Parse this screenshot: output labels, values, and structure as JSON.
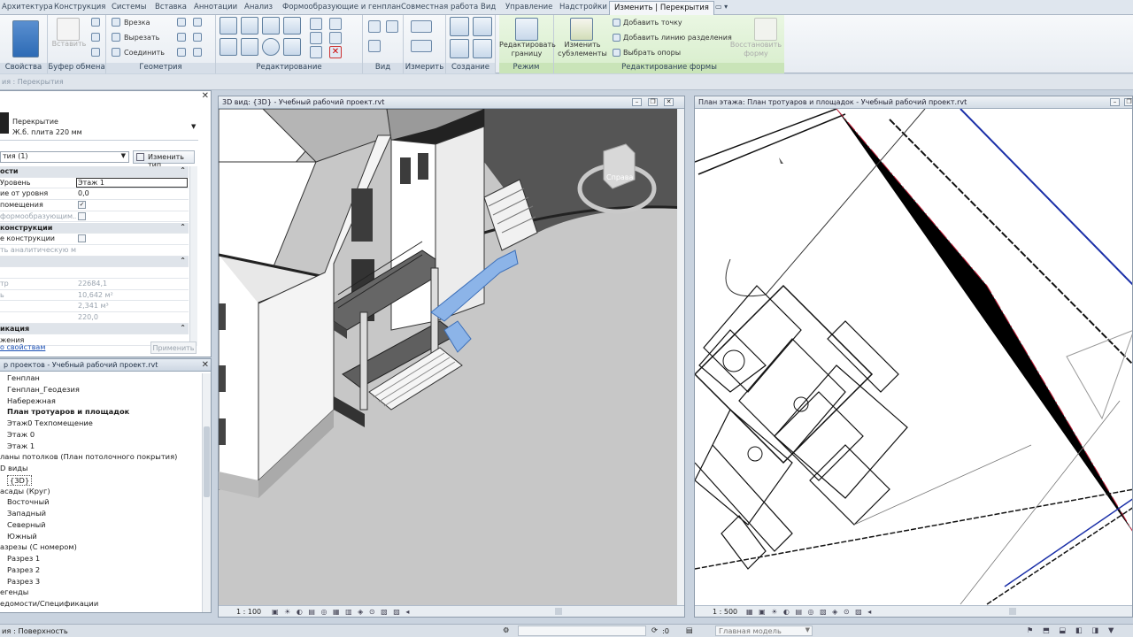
{
  "ribbon_tabs": [
    "Архитектура",
    "Конструкция",
    "Системы",
    "Вставка",
    "Аннотации",
    "Анализ",
    "Формообразующие и генплан",
    "Совместная работа",
    "Вид",
    "Управление",
    "Надстройки",
    "Изменить | Перекрытия"
  ],
  "ribbon": {
    "groups": {
      "properties": "Свойства",
      "clipboard": "Буфер обмена",
      "geometry": "Геометрия",
      "modify": "Редактирование",
      "view": "Вид",
      "measure": "Измерить",
      "create": "Создание",
      "mode": "Режим",
      "shape_editing": "Редактирование формы"
    },
    "paste": "Вставить",
    "notch": "Врезка",
    "cut": "Вырезать",
    "join": "Соединить",
    "edit_boundary": "Редактировать границу",
    "modify_subelements": "Изменить субэлементы",
    "add_point": "Добавить точку",
    "add_split_line": "Добавить линию разделения",
    "pick_supports": "Выбрать опоры",
    "reset_shape": "Восстановить форму"
  },
  "options_bar": "ия : Перекрытия",
  "properties": {
    "family": "Перекрытие",
    "type": "Ж.б. плита 220 мм",
    "filter": "тия (1)",
    "edit_type": "Изменить тип",
    "rows": [
      {
        "k": "ости",
        "v": "",
        "sec": true
      },
      {
        "k": "Уровень",
        "v": "Этаж 1",
        "edit": true
      },
      {
        "k": "ие от уровня",
        "v": "0,0"
      },
      {
        "k": "помещения",
        "v": "",
        "check": "✓"
      },
      {
        "k": "формообразующим...",
        "v": "",
        "check": "",
        "dim": true
      },
      {
        "k": "конструкции",
        "v": "",
        "sec": true
      },
      {
        "k": "е конструкции",
        "v": "",
        "check": ""
      },
      {
        "k": "ть аналитическую м...",
        "v": "",
        "dim": true
      },
      {
        "k": "",
        "v": "",
        "sec": true
      },
      {
        "k": "",
        "v": ""
      },
      {
        "k": "тр",
        "v": "22684,1",
        "dim": true
      },
      {
        "k": "ь",
        "v": "10,642 м²",
        "dim": true
      },
      {
        "k": "",
        "v": "2,341 м³",
        "dim": true
      },
      {
        "k": "",
        "v": "220,0",
        "dim": true
      },
      {
        "k": "икация",
        "v": "",
        "sec": true
      },
      {
        "k": "жения",
        "v": ""
      }
    ],
    "help_link": "о свойствам",
    "apply": "Применить"
  },
  "browser": {
    "title": "р проектов - Учебный рабочий проект.rvt",
    "items": [
      {
        "t": "Генплан",
        "i": 1
      },
      {
        "t": "Генплан_Геодезия",
        "i": 1
      },
      {
        "t": "Набережная",
        "i": 1
      },
      {
        "t": "План тротуаров и площадок",
        "i": 1,
        "b": true
      },
      {
        "t": "Этаж0 Техпомещение",
        "i": 1
      },
      {
        "t": "Этаж 0",
        "i": 1
      },
      {
        "t": "Этаж 1",
        "i": 1
      },
      {
        "t": "ланы потолков (План потолочного покрытия)",
        "i": 0
      },
      {
        "t": "D виды",
        "i": 0
      },
      {
        "t": "{3D}",
        "i": 1,
        "sel": true
      },
      {
        "t": "асады (Круг)",
        "i": 0
      },
      {
        "t": "Восточный",
        "i": 1
      },
      {
        "t": "Западный",
        "i": 1
      },
      {
        "t": "Северный",
        "i": 1
      },
      {
        "t": "Южный",
        "i": 1
      },
      {
        "t": "азрезы (С номером)",
        "i": 0
      },
      {
        "t": "Разрез 1",
        "i": 1
      },
      {
        "t": "Разрез 2",
        "i": 1
      },
      {
        "t": "Разрез 3",
        "i": 1
      },
      {
        "t": "егенды",
        "i": 0
      },
      {
        "t": "едомости/Спецификации",
        "i": 0
      }
    ]
  },
  "view3d": {
    "title": "3D вид: {3D} - Учебный рабочий проект.rvt",
    "scale": "1 : 100",
    "cube": "Справа"
  },
  "plan": {
    "title": "План этажа: План тротуаров и площадок - Учебный рабочий проект.rvt",
    "scale": "1 : 500"
  },
  "status": {
    "left": "ия : Поверхность",
    "zero": ":0",
    "model": "Главная модель"
  }
}
